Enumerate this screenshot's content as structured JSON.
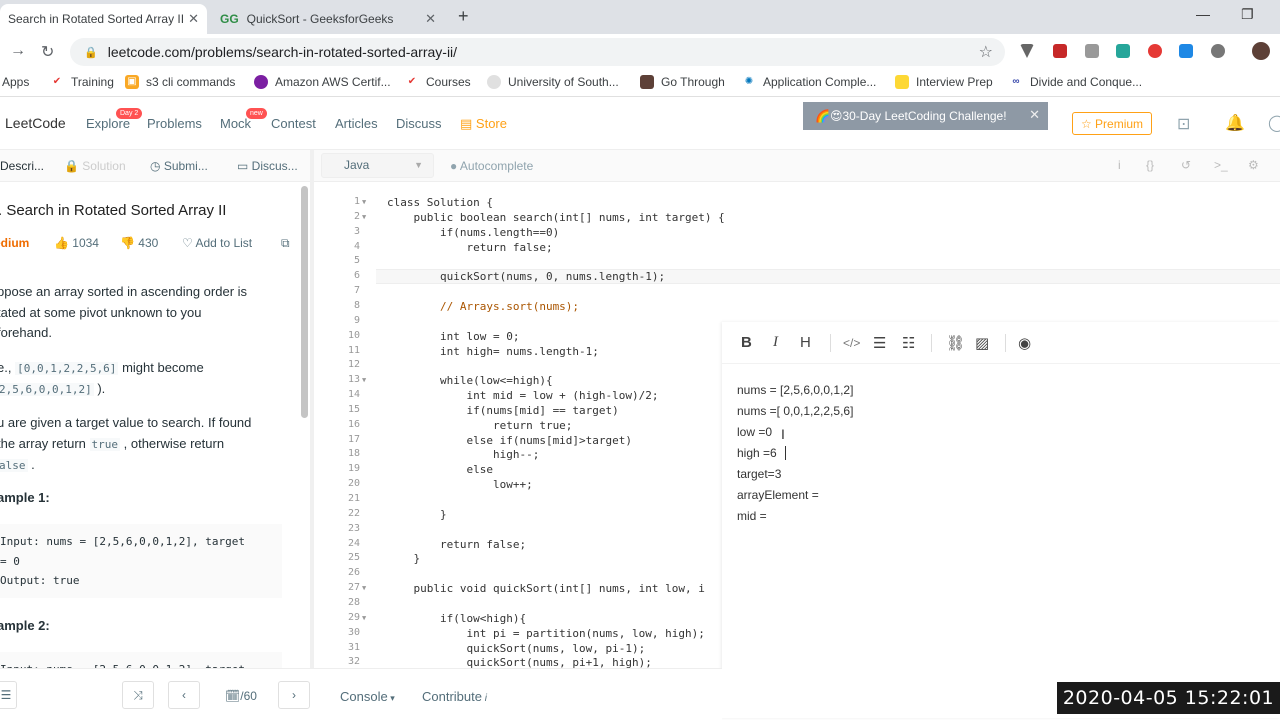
{
  "browser": {
    "tabs": [
      {
        "label": "Search in Rotated Sorted Array II",
        "active": true
      },
      {
        "label": "QuickSort - GeeksforGeeks",
        "active": false
      }
    ],
    "url": "leetcode.com/problems/search-in-rotated-sorted-array-ii/",
    "bookmarks": [
      "Apps",
      "Training",
      "s3 cli commands",
      "Amazon AWS Certif...",
      "Courses",
      "University of South...",
      "Go Through",
      "Application Comple...",
      "Interview Prep",
      "Divide and Conque..."
    ]
  },
  "lc_nav": {
    "logo": "LeetCode",
    "items": [
      "Explore",
      "Problems",
      "Mock",
      "Contest",
      "Articles",
      "Discuss",
      "Store"
    ],
    "badges": {
      "explore": "Day 2",
      "mock": "new"
    },
    "challenge": "🌈😍30-Day LeetCoding Challenge!",
    "premium": "☆ Premium"
  },
  "subtabs": [
    "Descri...",
    "Solution",
    "Submi...",
    "Discus..."
  ],
  "editor_bar": {
    "language": "Java",
    "autocomplete": "Autocomplete"
  },
  "problem": {
    "title": ". Search in Rotated Sorted Array II",
    "difficulty": "edium",
    "likes": "1034",
    "dislikes": "430",
    "add_to_list": "Add to List",
    "p1": [
      "ppose an array sorted in ascending order is",
      "tated at some pivot unknown to you",
      "forehand."
    ],
    "p2a": "e.,",
    "p2code": "[0,0,1,2,2,5,6]",
    "p2b": "might become",
    "p2c": "2,5,6,0,0,1,2]",
    "p2d": ").",
    "p3a": "u are given a target value to search. If found",
    "p3b": "the array return",
    "p3code": "true",
    "p3c": ", otherwise return",
    "p3d": "alse",
    "p3e": ".",
    "ex1_title": "ample 1:",
    "ex1_lines": [
      "Input: nums = [2,5,6,0,0,1,2], target",
      "= 0",
      "Output: true"
    ],
    "ex2_title": "ample 2:",
    "ex2_partial": "Input: nums = [2,5,6,0,0,1,2], target"
  },
  "code_lines": [
    "class Solution {",
    "    public boolean search(int[] nums, int target) {",
    "        if(nums.length==0)",
    "            return false;",
    "",
    "        quickSort(nums, 0, nums.length-1);",
    "",
    "        // Arrays.sort(nums);",
    "",
    "        int low = 0;",
    "        int high= nums.length-1;",
    "",
    "        while(low<=high){",
    "            int mid = low + (high-low)/2;",
    "            if(nums[mid] == target)",
    "                return true;",
    "            else if(nums[mid]>target)",
    "                high--;",
    "            else",
    "                low++;",
    "",
    "        }",
    "",
    "        return false;",
    "    }",
    "",
    "    public void quickSort(int[] nums, int low, i",
    "",
    "        if(low<high){",
    "            int pi = partition(nums, low, high);",
    "            quickSort(nums, low, pi-1);",
    "            quickSort(nums, pi+1, high);"
  ],
  "note": {
    "toolbar": [
      "B",
      "I",
      "H"
    ],
    "lines": [
      "nums = [2,5,6,0,0,1,2]",
      "nums =[ 0,0,1,2,2,5,6]",
      "low =0",
      "high =6",
      "target=3",
      "arrayElement =",
      "mid ="
    ]
  },
  "bottom": {
    "page": "/60",
    "console": "Console",
    "contribute": "Contribute"
  },
  "timestamp": "2020-04-05  15:22:01"
}
